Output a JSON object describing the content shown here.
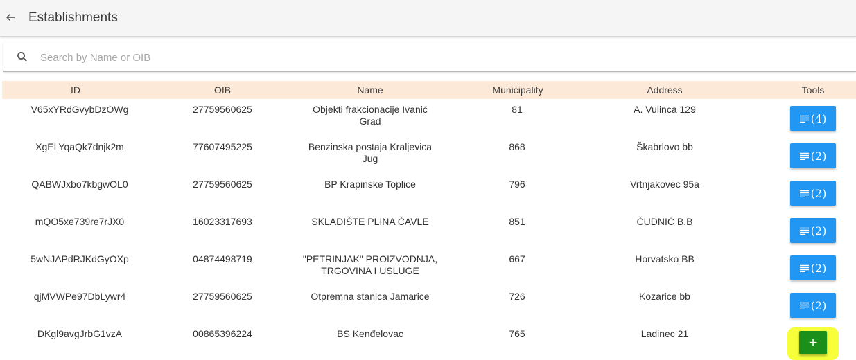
{
  "header": {
    "title": "Establishments",
    "back_icon": "arrow-left-icon"
  },
  "search": {
    "icon": "search-icon",
    "placeholder": "Search by Name or OIB",
    "value": ""
  },
  "table": {
    "header_color": "#fde9d8",
    "columns": [
      "ID",
      "OIB",
      "Name",
      "Municipality",
      "Address",
      "Tools"
    ],
    "rows": [
      {
        "id": "V65xYRdGvybDzOWg",
        "oib": "27759560625",
        "name": "Objekti frakcionacije Ivanić Grad",
        "municipality": "81",
        "address": "A. Vulinca 129",
        "tools": "(4)"
      },
      {
        "id": "XgELYqaQk7dnjk2m",
        "oib": "77607495225",
        "name": "Benzinska postaja Kraljevica Jug",
        "municipality": "868",
        "address": "Škabrlovo bb",
        "tools": "(2)"
      },
      {
        "id": "QABWJxbo7kbgwOL0",
        "oib": "27759560625",
        "name": "BP Krapinske Toplice",
        "municipality": "796",
        "address": "Vrtnjakovec 95a",
        "tools": "(2)"
      },
      {
        "id": "mQO5xe739re7rJX0",
        "oib": "16023317693",
        "name": "SKLADIŠTE PLINA ČAVLE",
        "municipality": "851",
        "address": "ČUDNIĆ B.B",
        "tools": "(2)"
      },
      {
        "id": "5wNJAPdRJKdGyOXp",
        "oib": "04874498719",
        "name": "\"PETRINJAK\" PROIZVODNJA, TRGOVINA I USLUGE",
        "municipality": "667",
        "address": "Horvatsko BB",
        "tools": "(2)"
      },
      {
        "id": "qjMVWPe97DbLywr4",
        "oib": "27759560625",
        "name": "Otpremna stanica Jamarice",
        "municipality": "726",
        "address": "Kozarice bb",
        "tools": "(2)"
      },
      {
        "id": "DKgl9avgJrbG1vzA",
        "oib": "00865396224",
        "name": "BS Kenđelovac",
        "municipality": "765",
        "address": "Ladinec 21",
        "tools": "+"
      }
    ]
  },
  "colors": {
    "tool_button": "#2196f3",
    "add_button": "#1a8f1a",
    "highlight": "#f6ff3a"
  }
}
